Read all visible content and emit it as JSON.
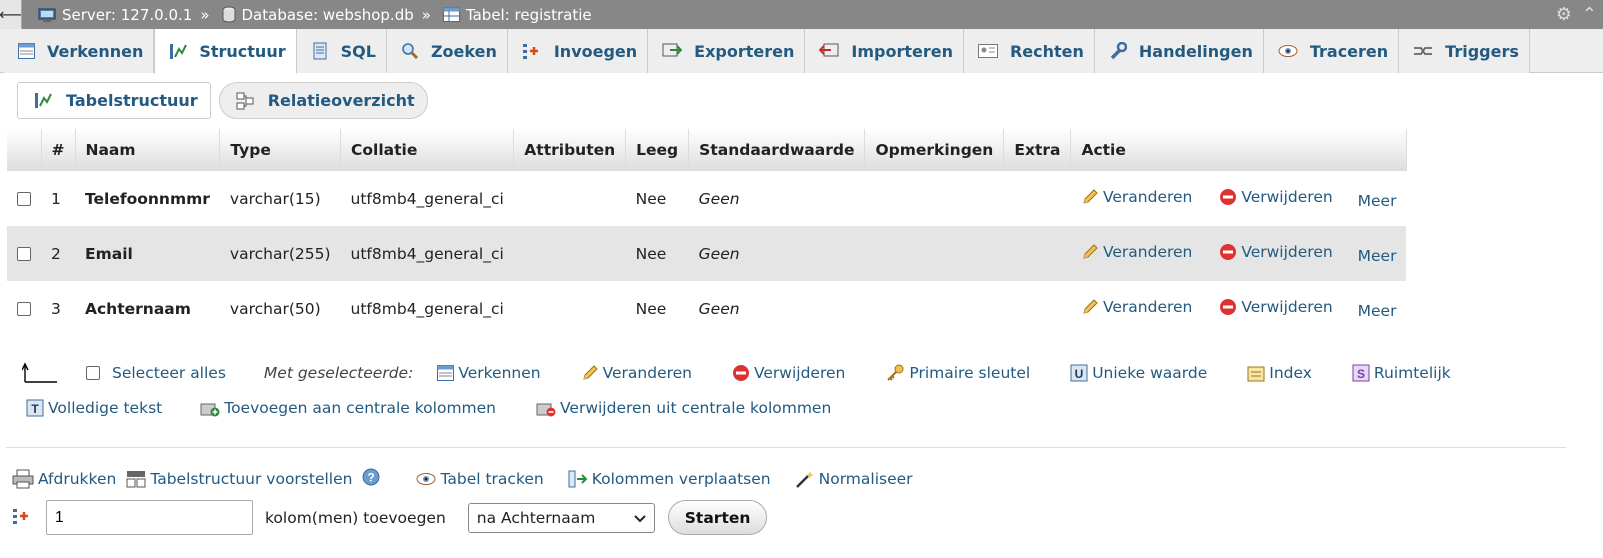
{
  "breadcrumb": {
    "back": "⟵",
    "server": "Server: 127.0.0.1",
    "database": "Database: webshop.db",
    "table": "Tabel: registratie",
    "sep": "»"
  },
  "tabs": [
    "Verkennen",
    "Structuur",
    "SQL",
    "Zoeken",
    "Invoegen",
    "Exporteren",
    "Importeren",
    "Rechten",
    "Handelingen",
    "Traceren",
    "Triggers"
  ],
  "subtabs": [
    "Tabelstructuur",
    "Relatieoverzicht"
  ],
  "table": {
    "headers": [
      "#",
      "Naam",
      "Type",
      "Collatie",
      "Attributen",
      "Leeg",
      "Standaardwaarde",
      "Opmerkingen",
      "Extra",
      "Actie"
    ],
    "rows": [
      {
        "num": "1",
        "name": "Telefoonnmmr",
        "type": "varchar(15)",
        "collation": "utf8mb4_general_ci",
        "attributes": "",
        "null": "Nee",
        "default": "Geen",
        "comments": "",
        "extra": ""
      },
      {
        "num": "2",
        "name": "Email",
        "type": "varchar(255)",
        "collation": "utf8mb4_general_ci",
        "attributes": "",
        "null": "Nee",
        "default": "Geen",
        "comments": "",
        "extra": ""
      },
      {
        "num": "3",
        "name": "Achternaam",
        "type": "varchar(50)",
        "collation": "utf8mb4_general_ci",
        "attributes": "",
        "null": "Nee",
        "default": "Geen",
        "comments": "",
        "extra": ""
      }
    ],
    "actions": {
      "change": "Veranderen",
      "drop": "Verwijderen",
      "more": "Meer"
    }
  },
  "bulk": {
    "select_all": "Selecteer alles",
    "with_selected": "Met geselecteerde:",
    "browse": "Verkennen",
    "change": "Veranderen",
    "drop": "Verwijderen",
    "primary": "Primaire sleutel",
    "unique": "Unieke waarde",
    "index": "Index",
    "spatial": "Ruimtelijk",
    "fulltext": "Volledige tekst",
    "add_central": "Toevoegen aan centrale kolommen",
    "remove_central": "Verwijderen uit centrale kolommen"
  },
  "bottom": {
    "print": "Afdrukken",
    "propose": "Tabelstructuur voorstellen",
    "track": "Tabel tracken",
    "move": "Kolommen verplaatsen",
    "normalize": "Normaliseer",
    "add_count": "1",
    "add_label": "kolom(men) toevoegen",
    "position": "na Achternaam",
    "go": "Starten"
  },
  "colors": {
    "link": "#235a81",
    "topbar": "#878787",
    "tabbar": "#eeeeee",
    "row_even": "#e5e5e5"
  }
}
